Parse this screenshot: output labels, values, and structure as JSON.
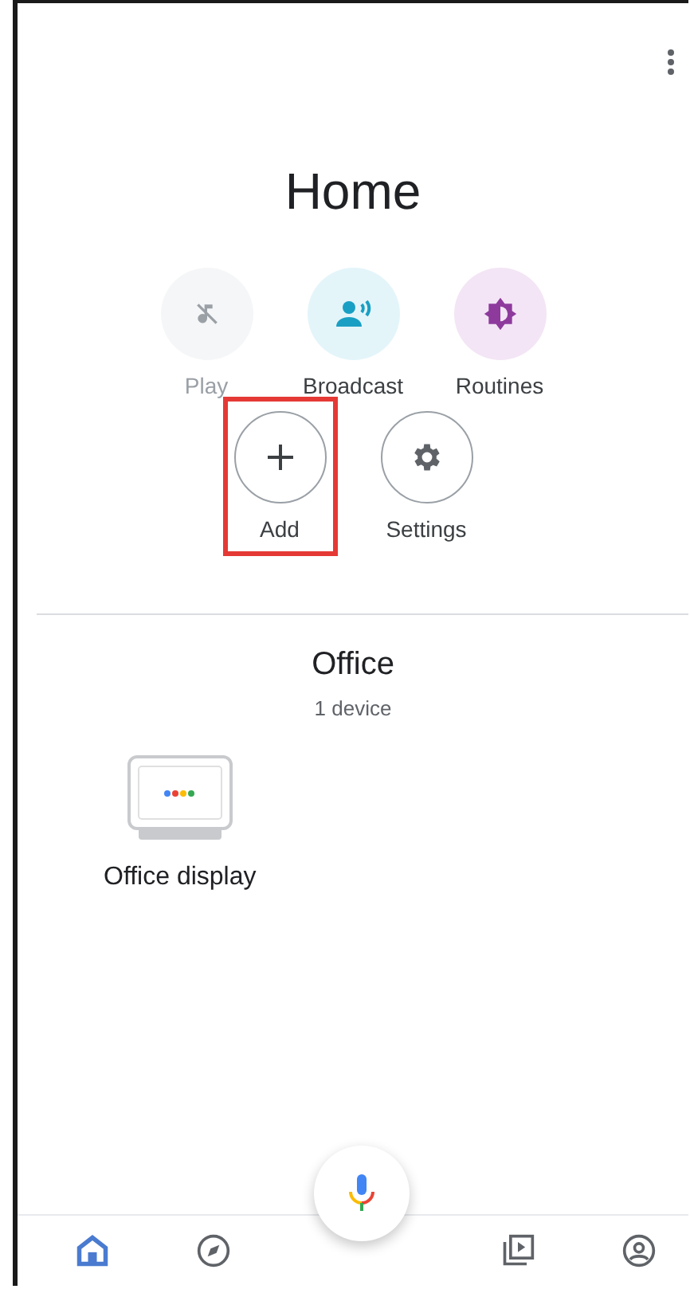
{
  "title": "Home",
  "actions": [
    {
      "label": "Play",
      "kind": "music-off",
      "disabled": true,
      "highlighted": false
    },
    {
      "label": "Broadcast",
      "kind": "broadcast",
      "disabled": false,
      "highlighted": false
    },
    {
      "label": "Routines",
      "kind": "routines",
      "disabled": false,
      "highlighted": false
    }
  ],
  "manage": [
    {
      "label": "Add",
      "kind": "add",
      "highlighted": true
    },
    {
      "label": "Settings",
      "kind": "settings",
      "highlighted": false
    }
  ],
  "room": {
    "name": "Office",
    "count": "1 device",
    "devices": [
      {
        "name": "Office display"
      }
    ]
  },
  "nav": [
    {
      "kind": "home",
      "selected": true
    },
    {
      "kind": "explore",
      "selected": false
    },
    {
      "kind": "mic",
      "selected": false
    },
    {
      "kind": "media",
      "selected": false
    },
    {
      "kind": "account",
      "selected": false
    }
  ]
}
